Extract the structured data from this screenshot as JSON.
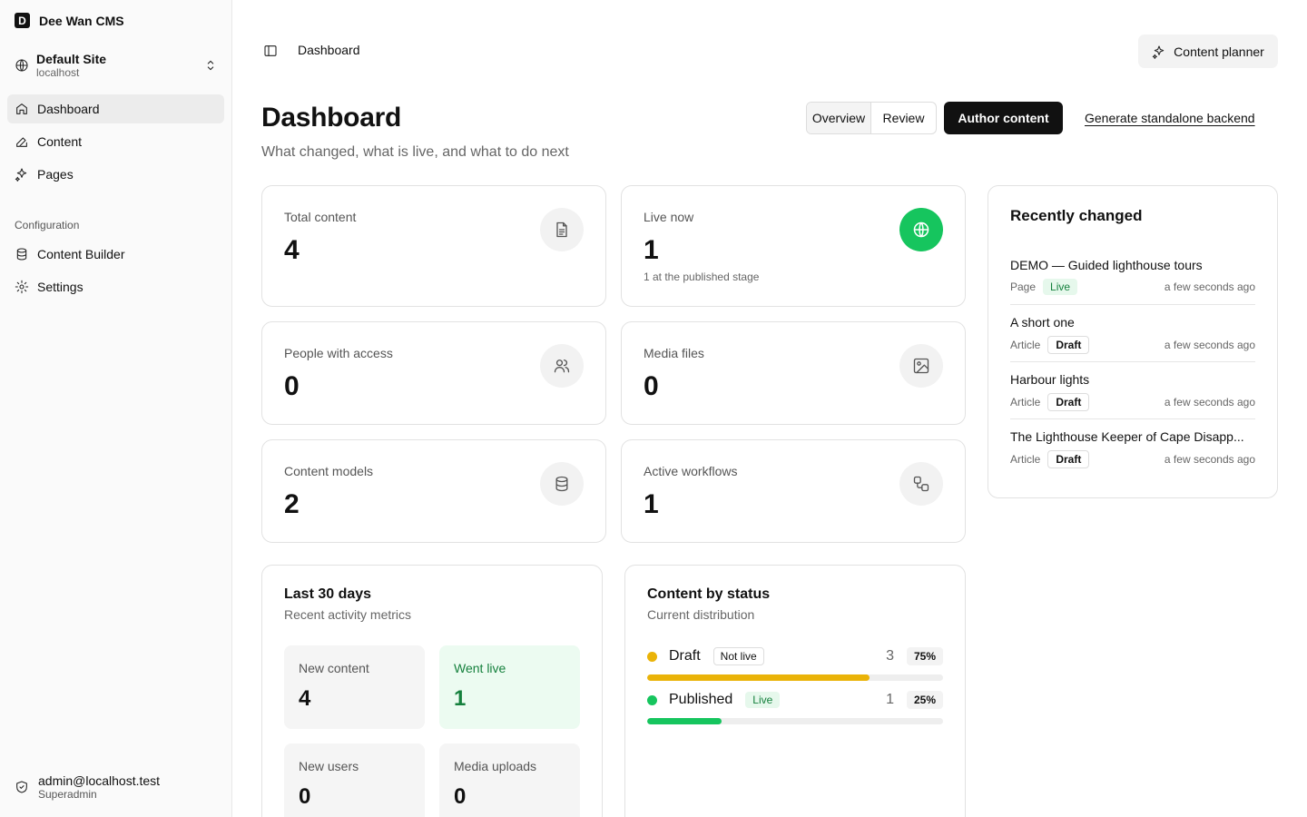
{
  "app": {
    "name": "Dee Wan CMS",
    "logo_letter": "D"
  },
  "site": {
    "name": "Default Site",
    "host": "localhost"
  },
  "nav": {
    "items": [
      {
        "label": "Dashboard",
        "icon": "home-icon",
        "active": true
      },
      {
        "label": "Content",
        "icon": "edit-icon"
      },
      {
        "label": "Pages",
        "icon": "sparkles-icon"
      }
    ],
    "config_title": "Configuration",
    "config_items": [
      {
        "label": "Content Builder",
        "icon": "database-icon"
      },
      {
        "label": "Settings",
        "icon": "gear-icon"
      }
    ]
  },
  "user": {
    "email": "admin@localhost.test",
    "role": "Superadmin"
  },
  "topbar": {
    "breadcrumb": "Dashboard",
    "planner_label": "Content planner"
  },
  "header": {
    "title": "Dashboard",
    "subtitle": "What changed, what is live, and what to do next",
    "tabs": [
      "Overview",
      "Review"
    ],
    "author_label": "Author content",
    "generate_label": "Generate standalone backend"
  },
  "stats": [
    {
      "label": "Total content",
      "value": "4",
      "icon": "document-icon"
    },
    {
      "label": "Live now",
      "value": "1",
      "note": "1 at the published stage",
      "icon": "globe-icon"
    },
    {
      "label": "People with access",
      "value": "0",
      "icon": "users-icon"
    },
    {
      "label": "Media files",
      "value": "0",
      "icon": "image-icon"
    },
    {
      "label": "Content models",
      "value": "2",
      "icon": "database-icon"
    },
    {
      "label": "Active workflows",
      "value": "1",
      "icon": "workflow-icon"
    }
  ],
  "recent": {
    "title": "Recently changed",
    "items": [
      {
        "name": "DEMO — Guided lighthouse tours",
        "type": "Page",
        "status": "Live",
        "time": "a few seconds ago"
      },
      {
        "name": "A short one",
        "type": "Article",
        "status": "Draft",
        "time": "a few seconds ago"
      },
      {
        "name": "Harbour lights",
        "type": "Article",
        "status": "Draft",
        "time": "a few seconds ago"
      },
      {
        "name": "The Lighthouse Keeper of Cape Disapp...",
        "type": "Article",
        "status": "Draft",
        "time": "a few seconds ago"
      }
    ]
  },
  "last30": {
    "title": "Last 30 days",
    "subtitle": "Recent activity metrics",
    "metrics": [
      {
        "label": "New content",
        "value": "4"
      },
      {
        "label": "Went live",
        "value": "1"
      },
      {
        "label": "New users",
        "value": "0"
      },
      {
        "label": "Media uploads",
        "value": "0"
      }
    ]
  },
  "by_status": {
    "title": "Content by status",
    "subtitle": "Current distribution",
    "rows": [
      {
        "name": "Draft",
        "badge": "Not live",
        "count": "3",
        "pct": "75%",
        "fraction": 0.75,
        "color": "#eab308"
      },
      {
        "name": "Published",
        "badge": "Live",
        "count": "1",
        "pct": "25%",
        "fraction": 0.25,
        "color": "#16c55e"
      }
    ]
  },
  "colors": {
    "accent_green": "#16c55e",
    "draft_yellow": "#eab308",
    "primary_dark": "#111111"
  }
}
